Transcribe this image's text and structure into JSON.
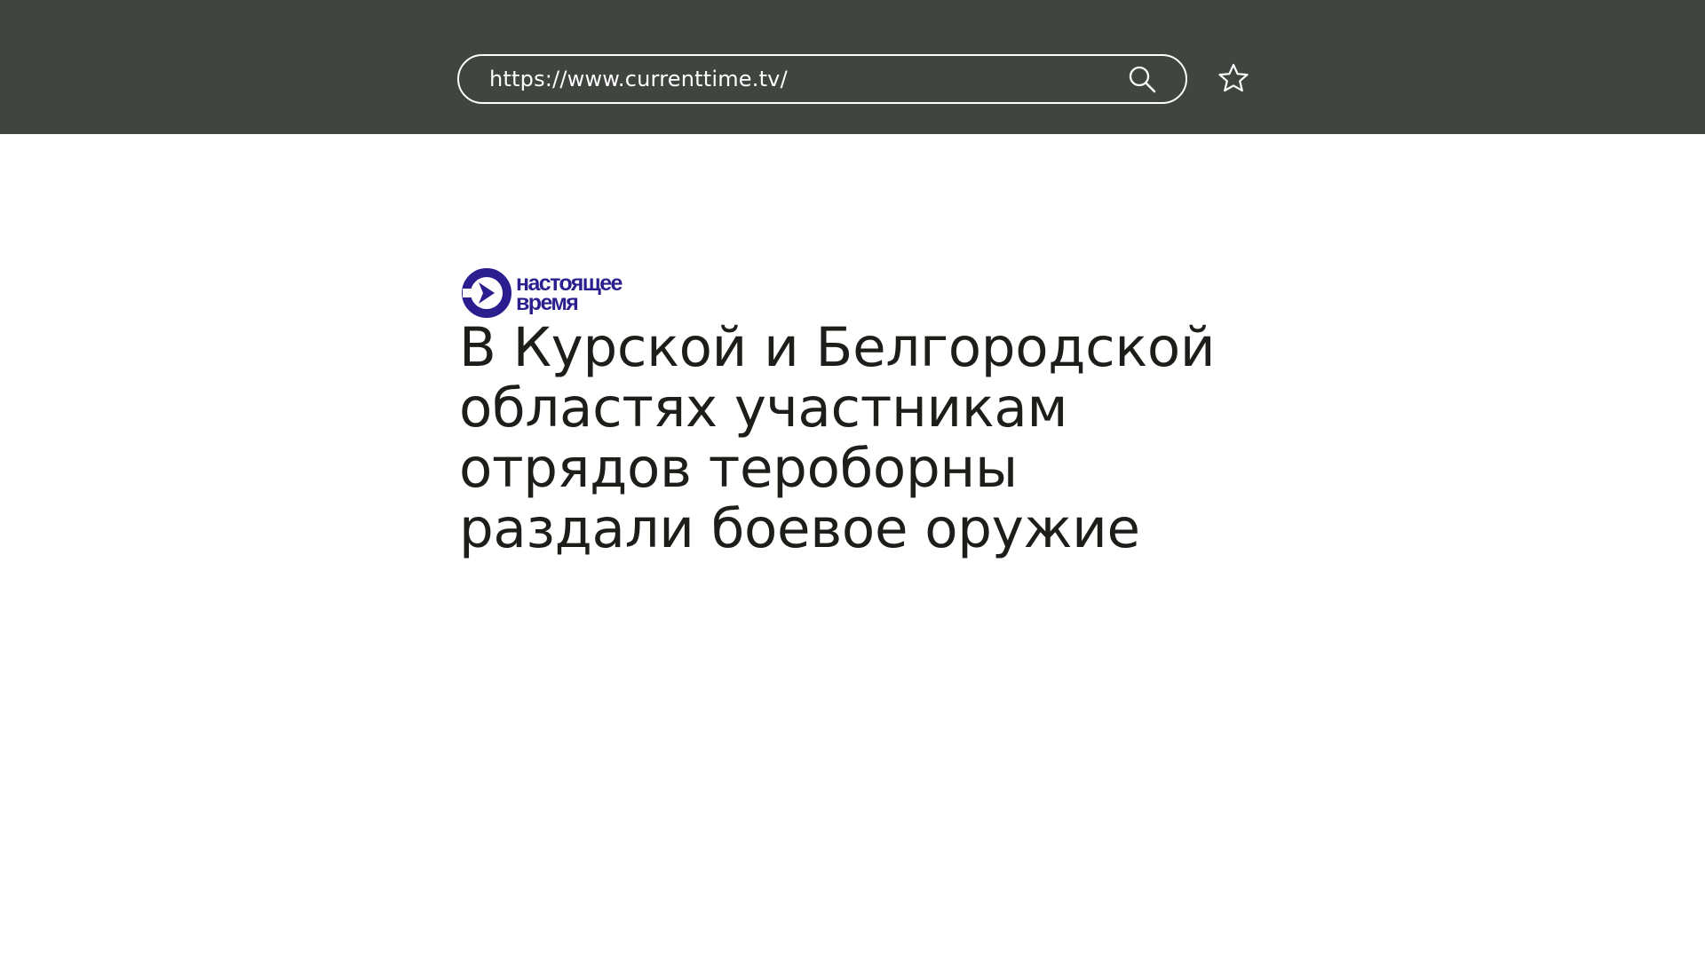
{
  "browser": {
    "url": "https://www.currenttime.tv/",
    "search_icon": "search-icon",
    "bookmark_icon": "star-icon"
  },
  "logo": {
    "line1": "настоящее",
    "line2": "время",
    "mark_icon": "play-arrow-circle-icon"
  },
  "article": {
    "headline_lines": [
      "В Курской и Белгородской",
      "областях участникам",
      "отрядов тероборны",
      "раздали боевое оружие"
    ]
  },
  "colors": {
    "topbar": "#404540",
    "text_dark": "#1f1d1a",
    "brand_blue": "#2b1f8f"
  }
}
